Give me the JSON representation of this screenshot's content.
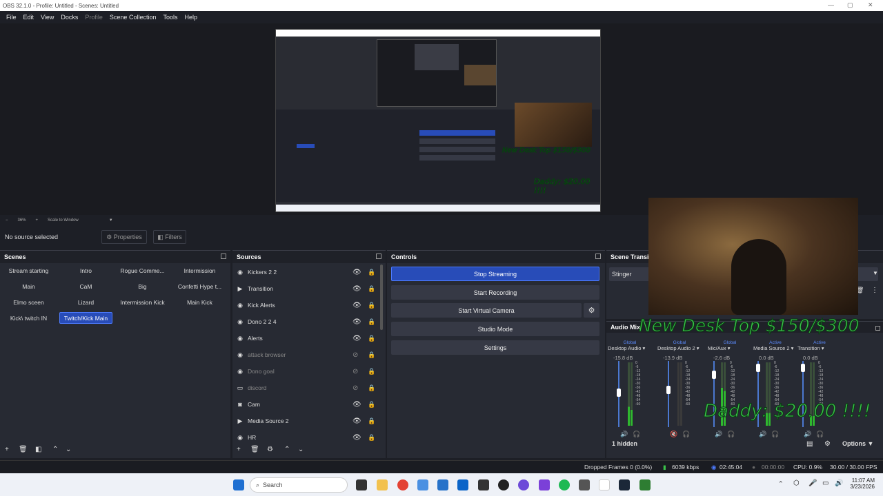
{
  "window": {
    "title": "OBS 32.1.0 - Profile: Untitled - Scenes: Untitled"
  },
  "menu": [
    {
      "label": "File",
      "disabled": false
    },
    {
      "label": "Edit",
      "disabled": false
    },
    {
      "label": "View",
      "disabled": false
    },
    {
      "label": "Docks",
      "disabled": false
    },
    {
      "label": "Profile",
      "disabled": true
    },
    {
      "label": "Scene Collection",
      "disabled": false
    },
    {
      "label": "Tools",
      "disabled": false
    },
    {
      "label": "Help",
      "disabled": false
    }
  ],
  "zoom": {
    "minus": "−",
    "percent": "36%",
    "plus": "+",
    "mode": "Scale to Window"
  },
  "source_bar": {
    "selected": "No source selected",
    "properties": "Properties",
    "filters": "Filters"
  },
  "scenes": {
    "title": "Scenes",
    "items": [
      {
        "label": "Stream starting",
        "active": false
      },
      {
        "label": "Intro",
        "active": false
      },
      {
        "label": "Rogue Comme...",
        "active": false
      },
      {
        "label": "Intermission",
        "active": false
      },
      {
        "label": "Main",
        "active": false
      },
      {
        "label": "CaM",
        "active": false
      },
      {
        "label": "Big",
        "active": false
      },
      {
        "label": "Confetti Hype t...",
        "active": false
      },
      {
        "label": "Elmo sceen",
        "active": false
      },
      {
        "label": "Lizard",
        "active": false
      },
      {
        "label": "Intermission Kick",
        "active": false
      },
      {
        "label": "Main Kick",
        "active": false
      },
      {
        "label": "Kick\\ twitch IN",
        "active": false
      },
      {
        "label": "Twitch/Kick Main",
        "active": true
      }
    ]
  },
  "sources": {
    "title": "Sources",
    "items": [
      {
        "label": "Kickers 2 2",
        "icon": "browser-icon",
        "visible": true
      },
      {
        "label": "Transition",
        "icon": "media-icon",
        "visible": true
      },
      {
        "label": "Kick Alerts",
        "icon": "browser-icon",
        "visible": true
      },
      {
        "label": "Dono 2 2 4",
        "icon": "browser-icon",
        "visible": true
      },
      {
        "label": "Alerts",
        "icon": "browser-icon",
        "visible": true
      },
      {
        "label": "attack browser",
        "icon": "browser-icon",
        "visible": false
      },
      {
        "label": "Dono goal",
        "icon": "browser-icon",
        "visible": false
      },
      {
        "label": "discord",
        "icon": "window-icon",
        "visible": false
      },
      {
        "label": "Cam",
        "icon": "camera-icon",
        "visible": true
      },
      {
        "label": "Media Source 2",
        "icon": "media-icon",
        "visible": true
      },
      {
        "label": "HR",
        "icon": "browser-icon",
        "visible": true
      }
    ]
  },
  "controls": {
    "title": "Controls",
    "stop_streaming": "Stop Streaming",
    "start_recording": "Start Recording",
    "start_virtual_camera": "Start Virtual Camera",
    "studio_mode": "Studio Mode",
    "settings": "Settings"
  },
  "transitions": {
    "title": "Scene Transi",
    "selected": "Stinger"
  },
  "mixer": {
    "title": "Audio Mix",
    "hidden_count": "1 hidden",
    "options": "Options",
    "channels": [
      {
        "name": "Desktop Audio",
        "db": "-15.8 dB",
        "tag": "Global"
      },
      {
        "name": "Desktop Audio 2",
        "db": "-13.9 dB",
        "tag": "Global"
      },
      {
        "name": "Mic/Aux",
        "db": "-2.6 dB",
        "tag": "Global"
      },
      {
        "name": "Media Source 2",
        "db": "0.0 dB",
        "tag": "Active"
      },
      {
        "name": "Transition",
        "db": "0.0 dB",
        "tag": "Active"
      }
    ],
    "scale": [
      "0",
      "-6",
      "-12",
      "-18",
      "-24",
      "-30",
      "-36",
      "-42",
      "-48",
      "-54",
      "-60"
    ]
  },
  "overlay": {
    "desk_text": "New Desk Top $150/$300",
    "daddy_text": "Daddy: $20.00 !!!!"
  },
  "status": {
    "dropped": "Dropped Frames 0 (0.0%)",
    "bitrate": "6039 kbps",
    "stream_time": "02:45:04",
    "rec_time": "00:00:00",
    "cpu": "CPU: 0.9%",
    "fps": "30.00 / 30.00 FPS"
  },
  "taskbar": {
    "search": "Search",
    "time": "11:07 AM",
    "date": "3/23/2026"
  },
  "colors": {
    "accent": "#284cb8",
    "panel": "#272a33",
    "bg": "#1d1f26"
  }
}
